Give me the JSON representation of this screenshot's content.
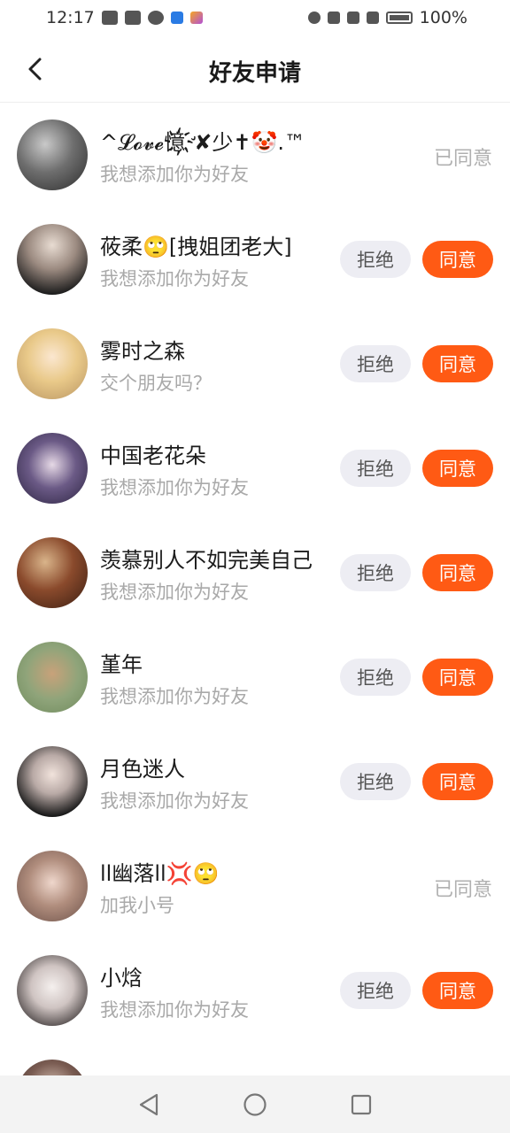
{
  "status_bar": {
    "time": "12:17",
    "battery": "100%"
  },
  "header": {
    "title": "好友申请"
  },
  "requests": [
    {
      "name": "^𝓛𝓸𝓿𝓮憶҉̛✘少✝🤡.™",
      "message": "我想添加你为好友",
      "status": "已同意",
      "accepted": true
    },
    {
      "name": "莜柔🙄[拽姐团老大]",
      "message": "我想添加你为好友",
      "reject": "拒绝",
      "accept": "同意",
      "accepted": false
    },
    {
      "name": "雾时之森",
      "message": "交个朋友吗？",
      "reject": "拒绝",
      "accept": "同意",
      "accepted": false
    },
    {
      "name": "中国老花朵",
      "message": "我想添加你为好友",
      "reject": "拒绝",
      "accept": "同意",
      "accepted": false
    },
    {
      "name": "羡慕别人不如完美自己",
      "message": "我想添加你为好友",
      "reject": "拒绝",
      "accept": "同意",
      "accepted": false
    },
    {
      "name": "堇年",
      "message": "我想添加你为好友",
      "reject": "拒绝",
      "accept": "同意",
      "accepted": false
    },
    {
      "name": "月色迷人",
      "message": "我想添加你为好友",
      "reject": "拒绝",
      "accept": "同意",
      "accepted": false
    },
    {
      "name": "ll幽落ll💢🙄",
      "message": "加我小号",
      "status": "已同意",
      "accepted": true
    },
    {
      "name": "小焓",
      "message": "我想添加你为好友",
      "reject": "拒绝",
      "accept": "同意",
      "accepted": false
    }
  ],
  "colors": {
    "accept_bg": "#ff5a14",
    "reject_bg": "#ededf3",
    "secondary_text": "#a9a9a9"
  }
}
